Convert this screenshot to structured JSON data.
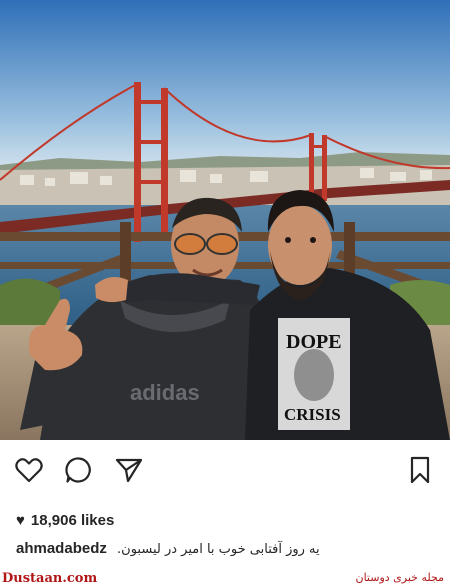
{
  "post": {
    "image_alt": "Two men posing in front of the 25 de Abril bridge in Lisbon",
    "likes": "18,906 likes",
    "username": "ahmadabedz",
    "caption": "یه روز آفتابی خوب با امیر در لیسبون.",
    "shirt_text_1": "DOPE",
    "shirt_text_2": "CRISIS",
    "jacket_text": "adidas"
  },
  "actions": {
    "like_icon": "heart-outline-icon",
    "comment_icon": "speech-bubble-icon",
    "share_icon": "paper-plane-icon",
    "save_icon": "bookmark-icon"
  },
  "watermark": {
    "left": "Dustaan.com",
    "right": "مجله خبری دوستان"
  },
  "colors": {
    "sky_top": "#2f6fb8",
    "sky_bottom": "#cfe0ee",
    "bridge": "#c0392b",
    "water": "#3d6f95",
    "watermark": "#b01818"
  }
}
